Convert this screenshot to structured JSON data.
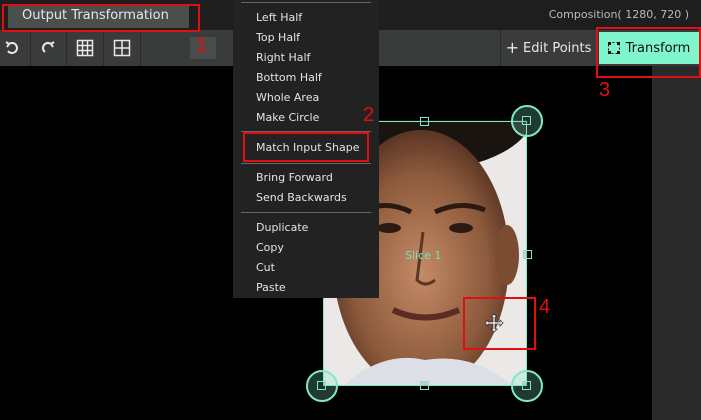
{
  "header": {
    "tab_title": "Output Transformation",
    "composition": "Composition( 1280, 720 )"
  },
  "toolbar": {
    "undo_icon": "undo-icon",
    "redo_icon": "redo-icon",
    "grid_icon": "grid-icon",
    "quad_icon": "quad-grid-icon",
    "edit_points_label": "Edit Points",
    "transform_label": "Transform"
  },
  "context_menu": {
    "items": [
      "Left Half",
      "Top Half",
      "Right Half",
      "Bottom Half",
      "Whole Area",
      "Make Circle",
      "Match Input Shape",
      "Bring Forward",
      "Send Backwards",
      "Duplicate",
      "Copy",
      "Cut",
      "Paste"
    ]
  },
  "canvas": {
    "slice_label": "Slice 1",
    "move_icon": "move-cursor-icon"
  },
  "annotations": {
    "labels": [
      "1",
      "2",
      "3",
      "4"
    ]
  },
  "colors": {
    "accent": "#7ff5cc",
    "highlight_red": "#e01010",
    "toolbar": "#3a3c3b"
  }
}
